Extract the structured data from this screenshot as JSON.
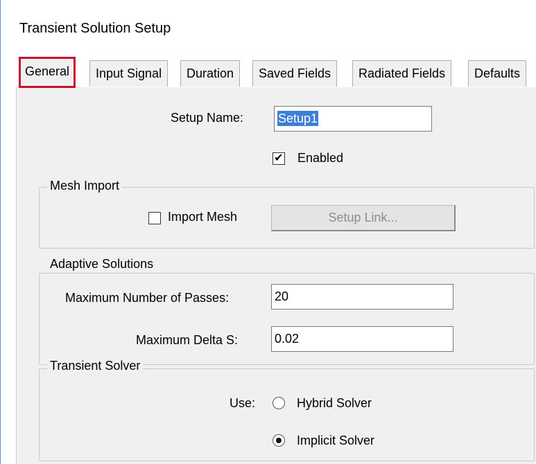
{
  "window": {
    "title": "Transient Solution Setup"
  },
  "tabs": [
    {
      "label": "General",
      "active": true
    },
    {
      "label": "Input Signal",
      "active": false
    },
    {
      "label": "Duration",
      "active": false
    },
    {
      "label": "Saved Fields",
      "active": false
    },
    {
      "label": "Radiated Fields",
      "active": false
    },
    {
      "label": "Defaults",
      "active": false
    }
  ],
  "general": {
    "setup_name_label": "Setup Name:",
    "setup_name_value": "Setup1",
    "enabled_label": "Enabled",
    "enabled_checked": true
  },
  "mesh_import": {
    "title": "Mesh Import",
    "import_mesh_label": "Import Mesh",
    "import_mesh_checked": false,
    "setup_link_label": "Setup Link..."
  },
  "adaptive": {
    "title": "Adaptive Solutions",
    "max_passes_label": "Maximum Number of Passes:",
    "max_passes_value": "20",
    "max_delta_label": "Maximum Delta S:",
    "max_delta_value": "0.02"
  },
  "solver": {
    "title": "Transient Solver",
    "use_label": "Use:",
    "options": [
      {
        "label": "Hybrid Solver",
        "selected": false
      },
      {
        "label": "Implicit Solver",
        "selected": true
      }
    ]
  },
  "colors": {
    "active_tab_highlight": "#c8102e",
    "selection": "#3d7fd6"
  }
}
